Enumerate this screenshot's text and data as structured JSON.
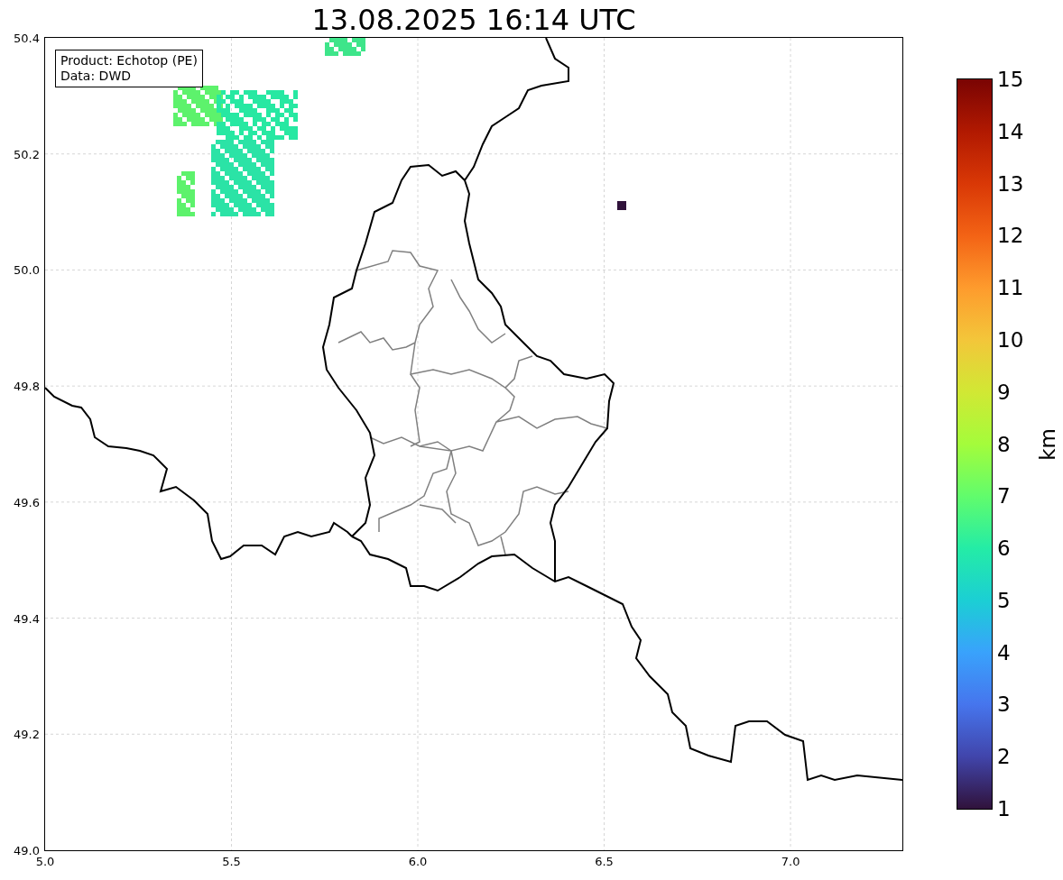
{
  "title": "13.08.2025 16:14 UTC",
  "info_box": [
    "Product: Echotop (PE)",
    "Data: DWD"
  ],
  "map": {
    "yticks": [
      "50.4",
      "50.2",
      "50.0",
      "49.8",
      "49.6",
      "49.4",
      "49.2",
      "49.0"
    ],
    "xticks": [
      "5.0",
      "5.5",
      "6.0",
      "6.5",
      "7.0"
    ]
  },
  "colorbar": {
    "label": "km",
    "ticks": [
      "15",
      "14",
      "13",
      "12",
      "11",
      "10",
      "9",
      "8",
      "7",
      "6",
      "5",
      "4",
      "3",
      "2",
      "1"
    ]
  }
}
